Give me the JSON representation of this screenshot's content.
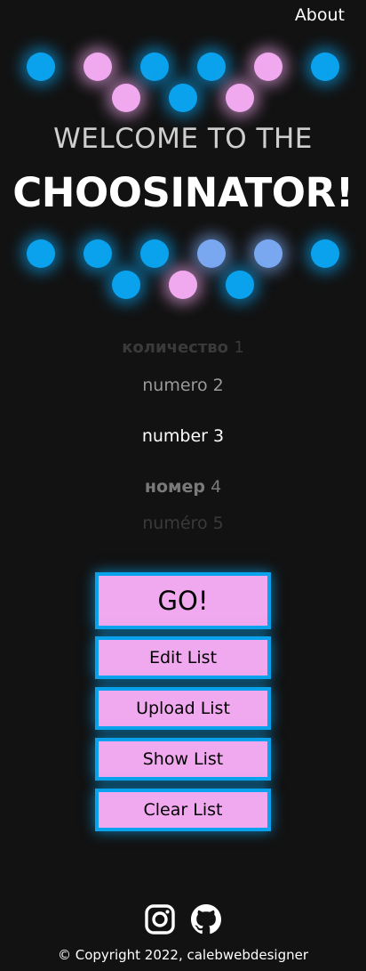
{
  "nav": {
    "about_label": "About"
  },
  "header": {
    "welcome": "WELCOME TO THE",
    "title": "CHOOSINATOR!"
  },
  "colors": {
    "background": "#121212",
    "light_blue": "#0aa2ec",
    "light_pink": "#f0a8ee",
    "light_periwinkle": "#7aa8f0",
    "button_fill": "#f0a8ee",
    "button_border": "#0aa2ec"
  },
  "lights_top": {
    "row1": [
      "blue",
      "pink",
      "blue",
      "blue",
      "pink",
      "blue"
    ],
    "row2": [
      "pink",
      "blue",
      "pink"
    ]
  },
  "lights_bottom": {
    "row1": [
      "blue",
      "blue",
      "blue",
      "periwinkle",
      "periwinkle",
      "blue"
    ],
    "row2": [
      "blue",
      "pink",
      "blue"
    ]
  },
  "list": {
    "items": [
      {
        "word": "количество",
        "num": "1"
      },
      {
        "word": "numero",
        "num": "2"
      },
      {
        "word": "number",
        "num": "3"
      },
      {
        "word": "номер",
        "num": "4"
      },
      {
        "word": "numéro",
        "num": "5"
      }
    ],
    "selected_index": 2
  },
  "buttons": {
    "go": "GO!",
    "edit": "Edit List",
    "upload": "Upload List",
    "show": "Show List",
    "clear": "Clear List"
  },
  "social": {
    "instagram_icon": "instagram-icon",
    "github_icon": "github-icon"
  },
  "footer": {
    "copyright": "© Copyright 2022, calebwebdesigner"
  }
}
